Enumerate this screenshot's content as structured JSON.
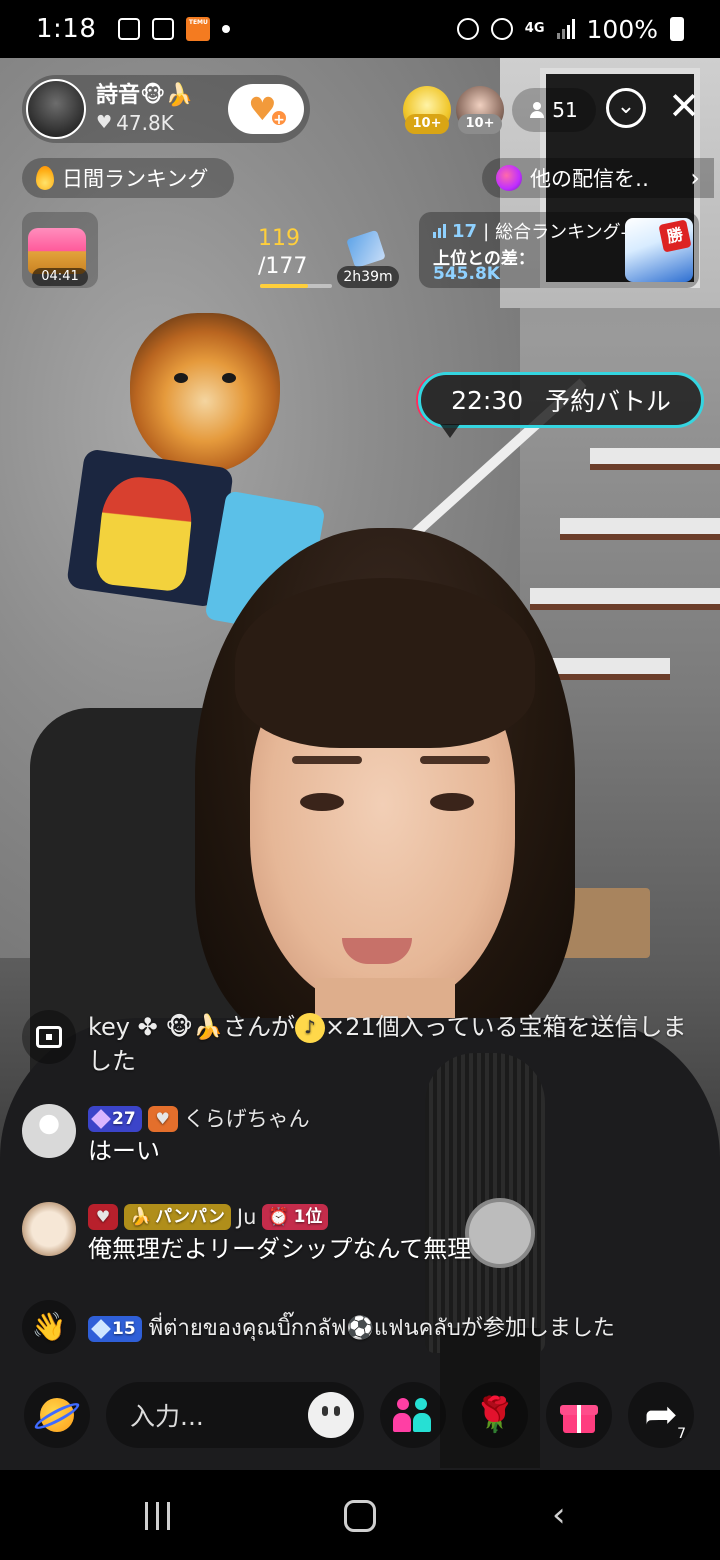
{
  "status_bar": {
    "time": "1:18",
    "temu_label": "TEMU",
    "network": "4G",
    "battery": "100%"
  },
  "host": {
    "name": "詩音🐵🍌",
    "likes": "47.8K"
  },
  "viewers": {
    "badges": [
      "10+",
      "10+"
    ],
    "count": "51"
  },
  "ranking_pill": {
    "label": "日間ランキング"
  },
  "other_streams": {
    "label": "他の配信を‥"
  },
  "treasure": {
    "timer": "04:41"
  },
  "goal": {
    "current": "119",
    "target": "/177",
    "progress": 0.672,
    "timer": "2h39m"
  },
  "total_ranking": {
    "rank": "17",
    "title": "総合ランキング-総合",
    "gap_label": "上位との差：",
    "gap_value": "545.8K",
    "badge_text": "勝"
  },
  "battle": {
    "time": "22:30",
    "label": "予約バトル"
  },
  "comments": [
    {
      "type": "system",
      "prefix": "key ✤ 🐵🍌さんが",
      "coin": "♪",
      "suffix": "×21個入っている宝箱を送信しました"
    },
    {
      "type": "user",
      "level": "27",
      "user": "くらげちゃん",
      "text": "はーい"
    },
    {
      "type": "user",
      "fan_tag": "パンパン",
      "user": "Ju",
      "rank_tag": "1位",
      "text": "俺無理だよリーダシップなんて無理"
    },
    {
      "type": "join",
      "level": "15",
      "text": "พี่ต่ายของคุณบิ๊กกลัฟ⚽แฟนคลับが参加しました"
    }
  ],
  "bottom_bar": {
    "input_placeholder": "入力...",
    "share_count": "7"
  },
  "colors": {
    "goal_yellow": "#ffcf3b",
    "rank_blue": "#8fd1ff",
    "battle_border_cyan": "#35d5e0",
    "battle_border_pink": "#ff2d5c",
    "gift_pink": "#ff3d7f"
  },
  "icons": [
    "image-icon",
    "calendar-icon",
    "alarm-icon",
    "hotspot-icon",
    "signal-icon",
    "battery-icon",
    "heart-icon",
    "person-icon",
    "chevron-down-icon",
    "close-icon",
    "flame-icon",
    "planet-icon",
    "chevron-right-icon",
    "treasure-chest-icon",
    "gift-box-icon",
    "bar-chart-icon",
    "wave-hand-icon",
    "emoji-icon",
    "people-icon",
    "rose-icon",
    "gift-icon",
    "share-icon"
  ]
}
